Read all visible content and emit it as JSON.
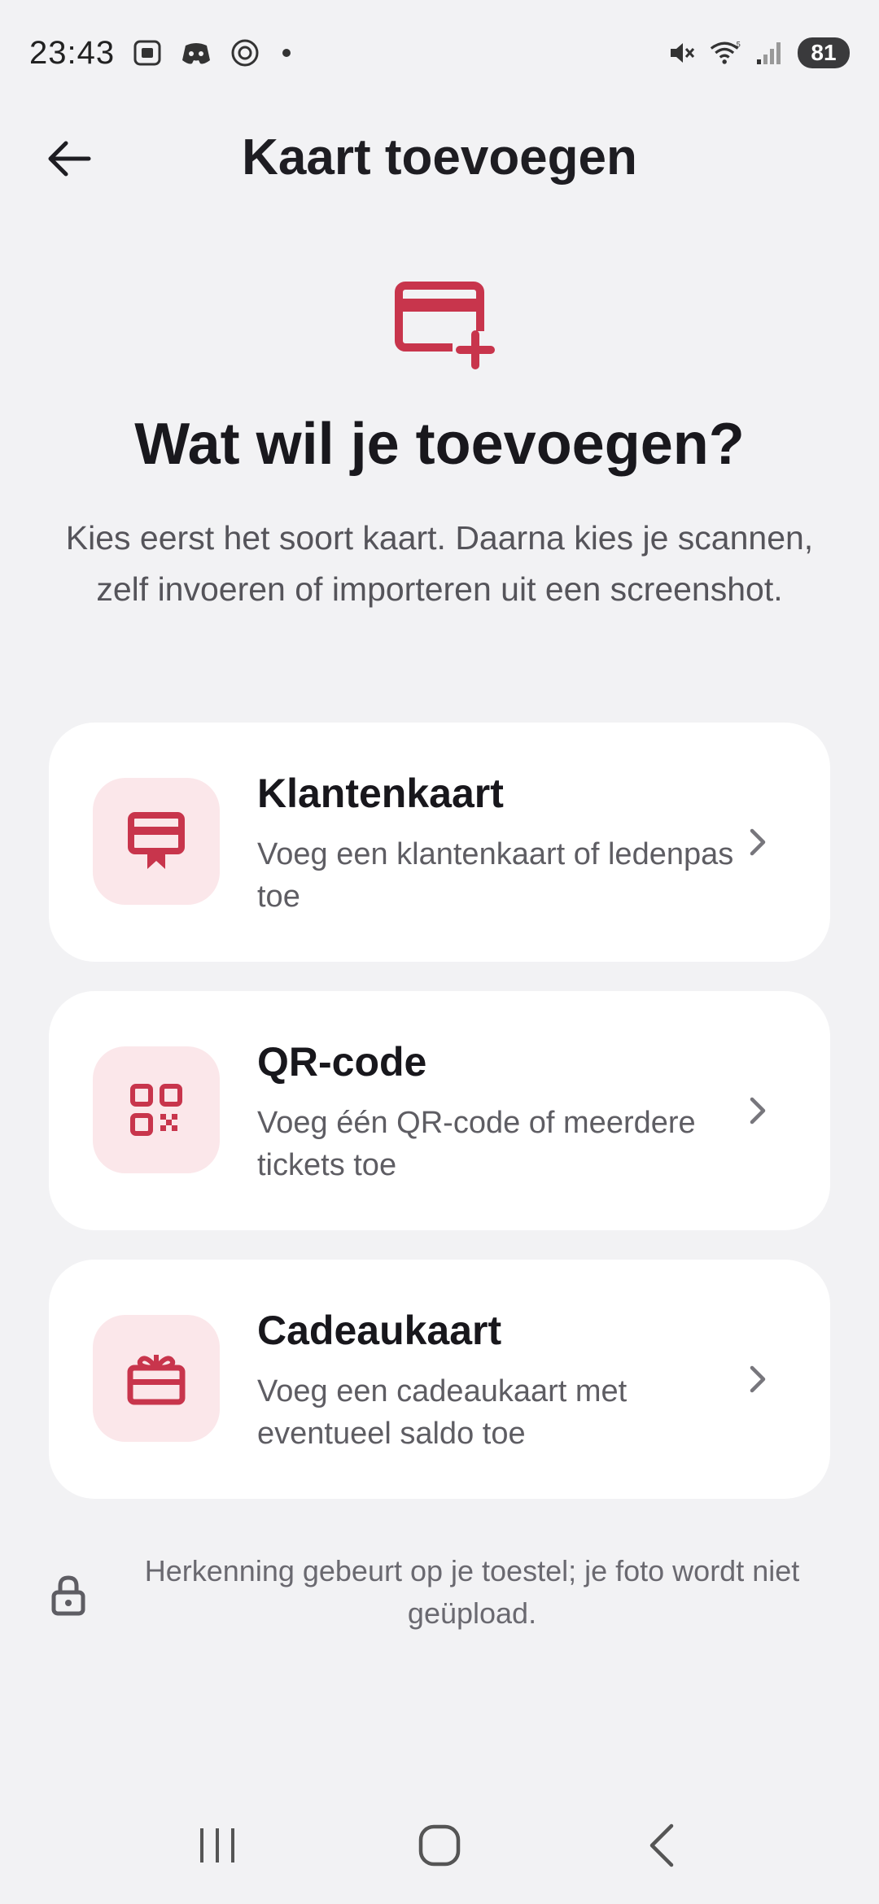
{
  "status_bar": {
    "time": "23:43",
    "battery": "81",
    "left_icons": [
      "screenshot-icon",
      "discord-icon",
      "threads-icon"
    ],
    "right_icons": [
      "mute-icon",
      "wifi-icon",
      "signal-icon"
    ]
  },
  "app_bar": {
    "title": "Kaart toevoegen",
    "back_icon": "arrow-left-icon"
  },
  "hero": {
    "icon": "card-add-icon",
    "title": "Wat wil je toevoegen?",
    "subtitle": "Kies eerst het soort kaart. Daarna kies je scannen, zelf invoeren of importeren uit een screenshot."
  },
  "options": [
    {
      "icon": "loyalty-card-icon",
      "title": "Klantenkaart",
      "description": "Voeg een klantenkaart of ledenpas toe"
    },
    {
      "icon": "qr-code-icon",
      "title": "QR-code",
      "description": "Voeg één QR-code of meerdere tickets toe"
    },
    {
      "icon": "gift-card-icon",
      "title": "Cadeaukaart",
      "description": "Voeg een cadeaukaart met eventueel saldo toe"
    }
  ],
  "privacy_note": "Herkenning gebeurt op je toestel; je foto wordt niet geüpload.",
  "colors": {
    "accent": "#c8354c",
    "accent_bg": "#fbe7ea",
    "background": "#f2f2f4",
    "card": "#ffffff"
  }
}
